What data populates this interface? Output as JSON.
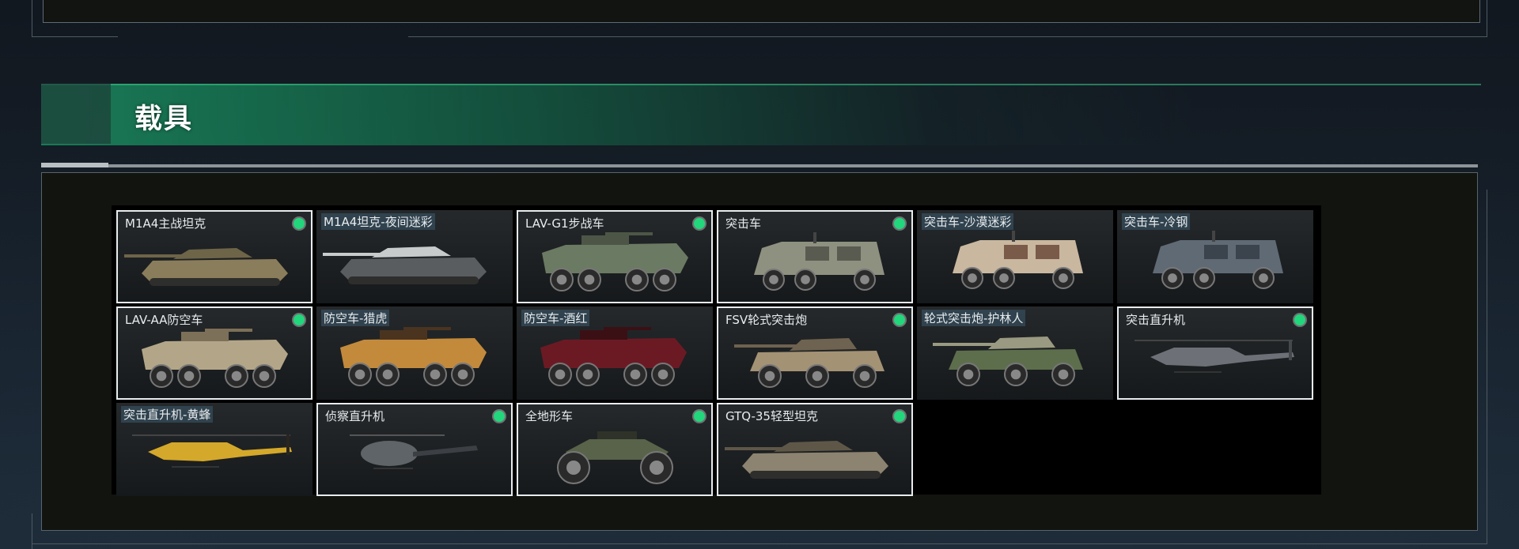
{
  "section": {
    "title": "载具"
  },
  "vehicles": [
    {
      "name": "M1A4主战坦克",
      "selected": true,
      "owned": true,
      "tagged": false,
      "icon": "tank-icon",
      "colors": [
        "#8a7d5c",
        "#6e6448"
      ]
    },
    {
      "name": "M1A4坦克-夜间迷彩",
      "selected": false,
      "owned": false,
      "tagged": true,
      "icon": "tank-icon",
      "colors": [
        "#5a5d60",
        "#c8cbcc"
      ]
    },
    {
      "name": "LAV-G1步战车",
      "selected": true,
      "owned": true,
      "tagged": false,
      "icon": "wheeled-apc-icon",
      "colors": [
        "#6b7a62",
        "#4d5646"
      ]
    },
    {
      "name": "突击车",
      "selected": true,
      "owned": true,
      "tagged": false,
      "icon": "armored-truck-icon",
      "colors": [
        "#8f9180",
        "#5a5b50"
      ]
    },
    {
      "name": "突击车-沙漠迷彩",
      "selected": false,
      "owned": false,
      "tagged": true,
      "icon": "armored-truck-icon",
      "colors": [
        "#c9b7a0",
        "#7a5a48"
      ]
    },
    {
      "name": "突击车-冷钢",
      "selected": false,
      "owned": false,
      "tagged": true,
      "icon": "armored-truck-icon",
      "colors": [
        "#5f6a75",
        "#3b434c"
      ]
    },
    {
      "name": "LAV-AA防空车",
      "selected": true,
      "owned": true,
      "tagged": false,
      "icon": "wheeled-apc-icon",
      "colors": [
        "#b3a688",
        "#7c7058"
      ]
    },
    {
      "name": "防空车-猎虎",
      "selected": false,
      "owned": false,
      "tagged": true,
      "icon": "wheeled-apc-icon",
      "colors": [
        "#c38a3c",
        "#4a3420"
      ]
    },
    {
      "name": "防空车-酒红",
      "selected": false,
      "owned": false,
      "tagged": true,
      "icon": "wheeled-apc-icon",
      "colors": [
        "#6b1a24",
        "#3a1015"
      ]
    },
    {
      "name": "FSV轮式突击炮",
      "selected": true,
      "owned": true,
      "tagged": false,
      "icon": "assault-gun-icon",
      "colors": [
        "#a49274",
        "#6e6250"
      ]
    },
    {
      "name": "轮式突击炮-护林人",
      "selected": false,
      "owned": false,
      "tagged": true,
      "icon": "assault-gun-icon",
      "colors": [
        "#5d6e4c",
        "#9a9a82"
      ]
    },
    {
      "name": "突击直升机",
      "selected": true,
      "owned": true,
      "tagged": false,
      "icon": "attack-helicopter-icon",
      "colors": [
        "#6d7177",
        "#45484c"
      ]
    },
    {
      "name": "突击直升机-黄蜂",
      "selected": false,
      "owned": false,
      "tagged": true,
      "icon": "attack-helicopter-icon",
      "colors": [
        "#d4a82a",
        "#2a2520"
      ]
    },
    {
      "name": "侦察直升机",
      "selected": true,
      "owned": true,
      "tagged": false,
      "icon": "scout-helicopter-icon",
      "colors": [
        "#5f6468",
        "#3c4044"
      ]
    },
    {
      "name": "全地形车",
      "selected": true,
      "owned": true,
      "tagged": false,
      "icon": "atv-icon",
      "colors": [
        "#58634a",
        "#2e3228"
      ]
    },
    {
      "name": "GTQ-35轻型坦克",
      "selected": true,
      "owned": true,
      "tagged": false,
      "icon": "tank-icon",
      "colors": [
        "#8c8370",
        "#5e5748"
      ]
    }
  ]
}
